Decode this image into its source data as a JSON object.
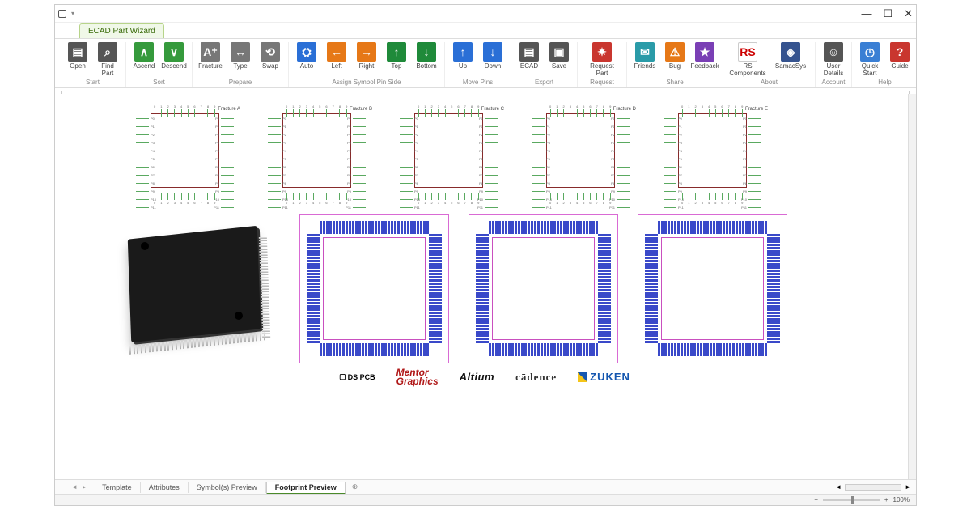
{
  "window": {
    "tab": "ECAD Part Wizard"
  },
  "ribbon": {
    "groups": [
      {
        "label": "Start",
        "buttons": [
          {
            "id": "open",
            "label": "Open",
            "cls": "c-dkgrey",
            "glyph": "▤"
          },
          {
            "id": "find-part",
            "label": "Find Part",
            "cls": "c-dkgrey",
            "glyph": "⌕"
          }
        ]
      },
      {
        "label": "Sort",
        "buttons": [
          {
            "id": "ascend",
            "label": "Ascend",
            "cls": "c-green",
            "glyph": "∧"
          },
          {
            "id": "descend",
            "label": "Descend",
            "cls": "c-green",
            "glyph": "∨"
          }
        ]
      },
      {
        "label": "Prepare",
        "buttons": [
          {
            "id": "fracture",
            "label": "Fracture",
            "cls": "c-grey",
            "glyph": "A⁺"
          },
          {
            "id": "type",
            "label": "Type",
            "cls": "c-grey",
            "glyph": "↔"
          },
          {
            "id": "swap",
            "label": "Swap",
            "cls": "c-grey",
            "glyph": "⟲"
          }
        ]
      },
      {
        "label": "Assign Symbol Pin Side",
        "buttons": [
          {
            "id": "auto",
            "label": "Auto",
            "cls": "c-blue",
            "glyph": "⛭"
          },
          {
            "id": "left",
            "label": "Left",
            "cls": "c-orange",
            "glyph": "←"
          },
          {
            "id": "right",
            "label": "Right",
            "cls": "c-orange",
            "glyph": "→"
          },
          {
            "id": "top",
            "label": "Top",
            "cls": "c-dgreen",
            "glyph": "↑"
          },
          {
            "id": "bottom",
            "label": "Bottom",
            "cls": "c-dgreen",
            "glyph": "↓"
          }
        ]
      },
      {
        "label": "Move Pins",
        "buttons": [
          {
            "id": "up",
            "label": "Up",
            "cls": "c-blue",
            "glyph": "↑"
          },
          {
            "id": "down",
            "label": "Down",
            "cls": "c-blue",
            "glyph": "↓"
          }
        ]
      },
      {
        "label": "Export",
        "buttons": [
          {
            "id": "ecad",
            "label": "ECAD",
            "cls": "c-dkgrey",
            "glyph": "▤"
          },
          {
            "id": "save",
            "label": "Save",
            "cls": "c-dkgrey",
            "glyph": "▣"
          }
        ]
      },
      {
        "label": "Request",
        "buttons": [
          {
            "id": "request",
            "label": "Request Part",
            "cls": "c-red",
            "glyph": "✷",
            "wide": true
          }
        ]
      },
      {
        "label": "Share",
        "buttons": [
          {
            "id": "friends",
            "label": "Friends",
            "cls": "c-teal",
            "glyph": "✉"
          },
          {
            "id": "bug",
            "label": "Bug",
            "cls": "c-orange",
            "glyph": "⚠"
          },
          {
            "id": "feedback",
            "label": "Feedback",
            "cls": "c-purple",
            "glyph": "★"
          }
        ]
      },
      {
        "label": "About",
        "buttons": [
          {
            "id": "rs",
            "label": "RS Components",
            "cls": "c-white",
            "glyph": "RS",
            "wide": true
          },
          {
            "id": "samacsys",
            "label": "SamacSys",
            "cls": "c-navy",
            "glyph": "◈",
            "wide": true
          }
        ]
      },
      {
        "label": "Account",
        "buttons": [
          {
            "id": "user",
            "label": "User Details",
            "cls": "c-dkgrey",
            "glyph": "☺"
          }
        ]
      },
      {
        "label": "Help",
        "buttons": [
          {
            "id": "quick",
            "label": "Quick Start",
            "cls": "c-blue2",
            "glyph": "◷"
          },
          {
            "id": "guide",
            "label": "Guide",
            "cls": "c-help",
            "glyph": "?"
          }
        ]
      }
    ]
  },
  "symbols": [
    "Fracture A",
    "Fracture B",
    "Fracture C",
    "Fracture D",
    "Fracture E"
  ],
  "logos": {
    "ds": "DS PCB",
    "mentor_l1": "Mentor",
    "mentor_l2": "Graphics",
    "altium": "Altium",
    "cadence": "cādence",
    "zuken": "ZUKEN"
  },
  "sheets": {
    "nav": "◄ ▸",
    "items": [
      "Template",
      "Attributes",
      "Symbol(s) Preview",
      "Footprint Preview"
    ],
    "active": 3,
    "add": "⊕"
  },
  "status": {
    "zoom": "100%"
  }
}
